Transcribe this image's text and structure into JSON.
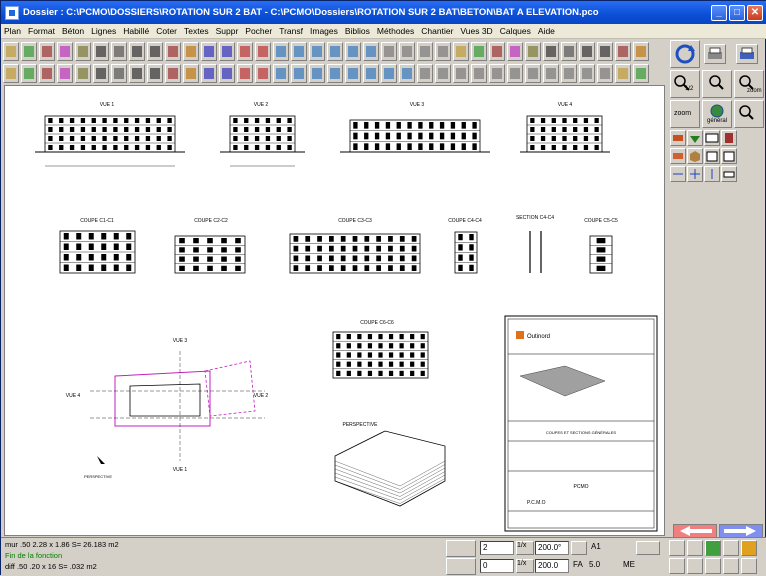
{
  "window": {
    "title": "Dossier : C:\\PCMO\\DOSSIERS\\ROTATION SUR 2 BAT - C:\\PCMO\\Dossiers\\ROTATION SUR 2 BAT\\BETON\\BAT A ELEVATION.pco",
    "minimize": "_",
    "maximize": "□",
    "close": "✕"
  },
  "menu": [
    "Plan",
    "Format",
    "Béton",
    "Lignes",
    "Habillé",
    "Coter",
    "Textes",
    "Suppr",
    "Pocher",
    "Transf",
    "Images",
    "Biblios",
    "Méthodes",
    "Chantier",
    "Vues 3D",
    "Calques",
    "Aide"
  ],
  "right_panel": {
    "zoom_half": "1/2",
    "zoom_minus": "zoom -",
    "zoom_label": "zoom",
    "zoom_plus": "zoom +",
    "zoom_link": "zoom",
    "general": "général"
  },
  "drawing": {
    "views": [
      "VUE 1",
      "VUE 2",
      "VUE 3",
      "VUE 4"
    ],
    "sections": [
      "COUPE C1-C1",
      "COUPE C2-C2",
      "COUPE C3-C3",
      "COUPE C4-C4",
      "SECTION C4-C4",
      "COUPE C5-C5",
      "COUPE C6-C6"
    ],
    "plan_labels": {
      "vue3": "VUE 3",
      "vue4": "VUE 4",
      "vue2": "VUE 2",
      "vue1": "VUE 1",
      "perspective_arrow": "PERSPECTIVE"
    },
    "perspective": "PERSPECTIVE",
    "cartouche": {
      "company": "Outinord",
      "subtitle": "COUPES ET SECTIONS GÉNÉRALES",
      "brand": "PCMO",
      "logo": "P.C.M.O"
    }
  },
  "status": {
    "line1": "mur  .50      2.28 x    1.86 S=    26.183 m2",
    "line2": "Fin de la fonction",
    "line3": "diff  .50       .20 x    16 S=       .032 m2",
    "field_a": "2",
    "field_b": "0",
    "scale1": "200.0°",
    "scale2": "200.0",
    "a1": "A1",
    "fa": "FA",
    "fa_val": "5.0",
    "me": "ME",
    "c1": "1/x",
    "c2": "1/x"
  }
}
